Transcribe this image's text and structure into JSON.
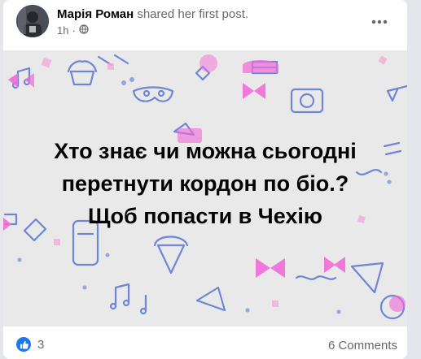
{
  "post": {
    "author": "Марія Роман",
    "action": " shared her first post.",
    "time": "1h",
    "separator": "·",
    "privacy_icon": "globe-icon",
    "more_icon": "ellipsis-icon",
    "text_lines": [
      "Хто знає чи можна сьогодні",
      "перетнути кордон по біо.?",
      "Щоб попасти в Чехію"
    ],
    "background_color": "#e9e9e9"
  },
  "footer": {
    "like_icon": "like-icon",
    "reaction_count": "3",
    "comments_label": "6 Comments"
  },
  "colors": {
    "accent": "#1877f2",
    "pattern_blue": "#6f86d6",
    "pattern_pink": "#f06bd8",
    "pattern_pink_light": "#f6a9d9"
  }
}
